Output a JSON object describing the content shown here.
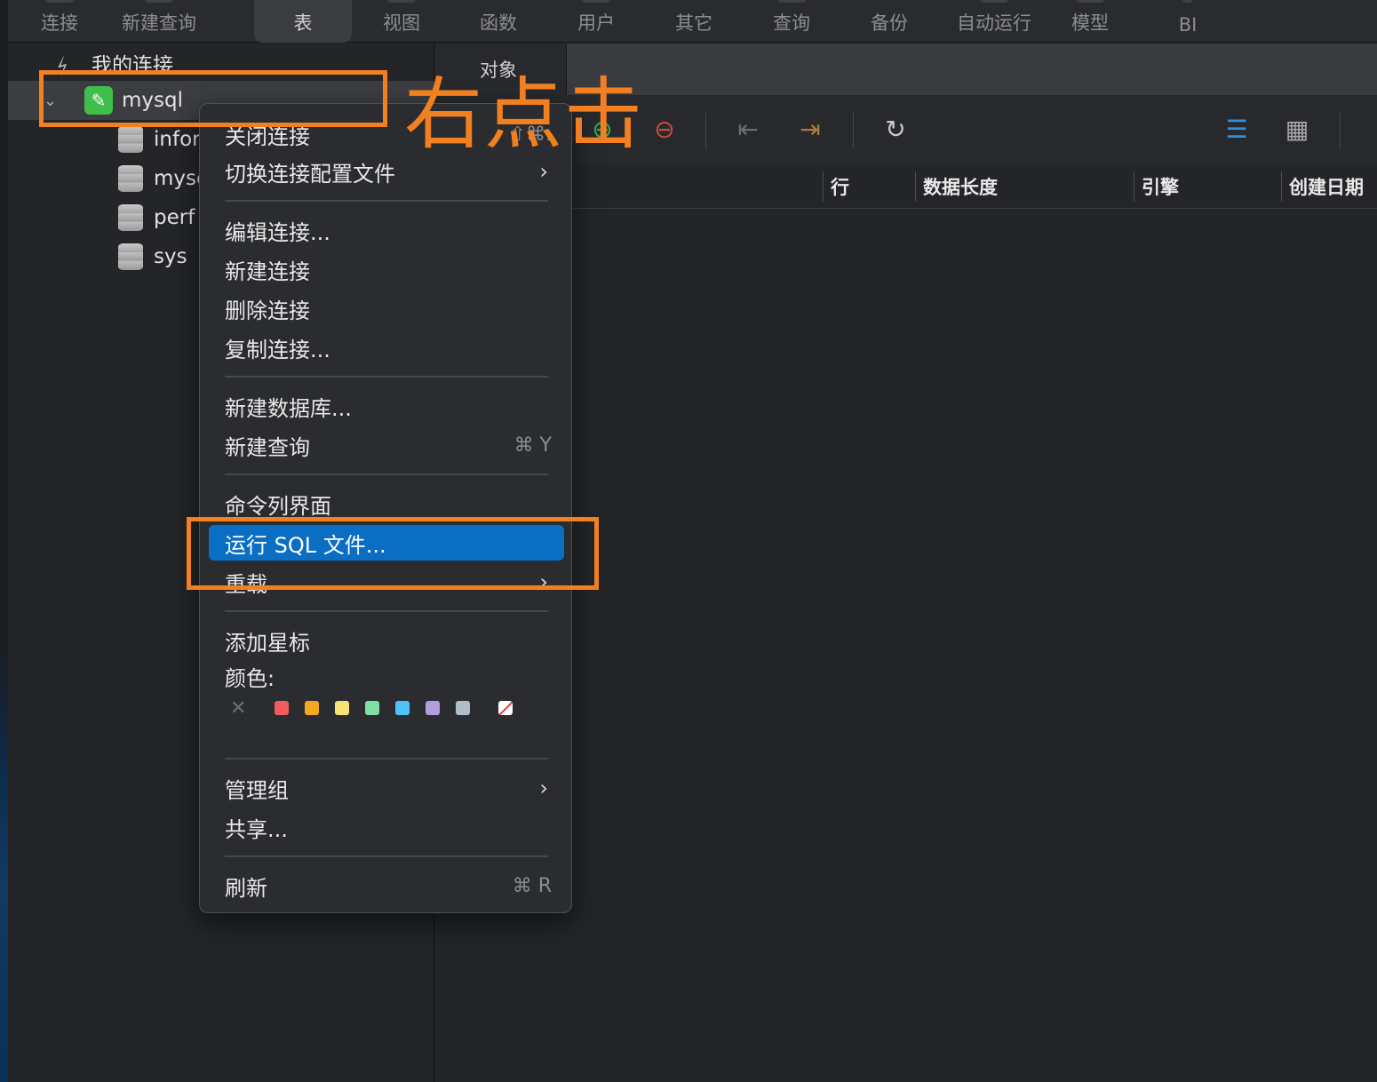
{
  "toolbar": {
    "items": [
      "连接",
      "新建查询",
      "表",
      "视图",
      "函数",
      "用户",
      "其它",
      "查询",
      "备份",
      "自动运行",
      "模型",
      "BI"
    ]
  },
  "sidebar": {
    "root_label": "我的连接",
    "connection": "mysql",
    "databases": [
      "infor",
      "mysc",
      "perf",
      "sys"
    ]
  },
  "main": {
    "tab_label": "对象",
    "columns": [
      "行",
      "数据长度",
      "引擎",
      "创建日期"
    ]
  },
  "context_menu": {
    "close_conn": "关闭连接",
    "close_conn_shortcut": "⇧⌘.",
    "switch_profile": "切换连接配置文件",
    "edit_conn": "编辑连接...",
    "new_conn": "新建连接",
    "delete_conn": "删除连接",
    "duplicate_conn": "复制连接...",
    "new_db": "新建数据库...",
    "new_query": "新建查询",
    "new_query_shortcut": "⌘ Y",
    "console": "命令列界面",
    "run_sql": "运行 SQL 文件...",
    "reload": "重载",
    "add_star": "添加星标",
    "color_label": "颜色:",
    "colors": [
      "#f25c5c",
      "#f5a623",
      "#f7e27a",
      "#7fe0a5",
      "#4fc3f7",
      "#b39ddb",
      "#b0bec5"
    ],
    "manage_group": "管理组",
    "share": "共享...",
    "refresh": "刷新",
    "refresh_shortcut": "⌘ R"
  },
  "annotation": {
    "text": "右点击",
    "color": "#f28020"
  }
}
